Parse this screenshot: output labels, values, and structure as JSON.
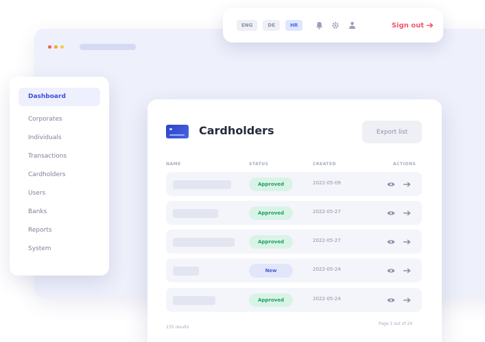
{
  "window": {
    "traffic_colors": [
      "#f25a6a",
      "#f5a623",
      "#f7c948"
    ]
  },
  "topbar": {
    "languages": [
      {
        "label": "ENG",
        "active": false
      },
      {
        "label": "DE",
        "active": false
      },
      {
        "label": "HR",
        "active": true
      }
    ],
    "icons": [
      "bell-icon",
      "gear-icon",
      "user-icon"
    ],
    "sign_out_label": "Sign out",
    "sign_out_icon": "arrow-right-icon"
  },
  "sidebar": {
    "items": [
      {
        "label": "Dashboard",
        "active": true
      },
      {
        "label": "Corporates",
        "active": false
      },
      {
        "label": "Individuals",
        "active": false
      },
      {
        "label": "Transactions",
        "active": false
      },
      {
        "label": "Cardholders",
        "active": false
      },
      {
        "label": "Users",
        "active": false
      },
      {
        "label": "Banks",
        "active": false
      },
      {
        "label": "Reports",
        "active": false
      },
      {
        "label": "System",
        "active": false
      }
    ]
  },
  "main": {
    "title": "Cardholders",
    "export_label": "Export list",
    "columns": [
      "NAME",
      "STATUS",
      "CREATED",
      "ACTIONS"
    ],
    "rows": [
      {
        "status": "Approved",
        "status_type": "approved",
        "date": "2022-05-09"
      },
      {
        "status": "Approved",
        "status_type": "approved",
        "date": "2022-05-27"
      },
      {
        "status": "Approved",
        "status_type": "approved",
        "date": "2022-05-27"
      },
      {
        "status": "New",
        "status_type": "new",
        "date": "2022-05-24"
      },
      {
        "status": "Approved",
        "status_type": "approved",
        "date": "2022-05-24"
      }
    ],
    "row_actions": [
      "eye-icon",
      "arrow-right-icon"
    ],
    "footer_count": "235 results",
    "footer_page": "Page 1 out of 24"
  }
}
